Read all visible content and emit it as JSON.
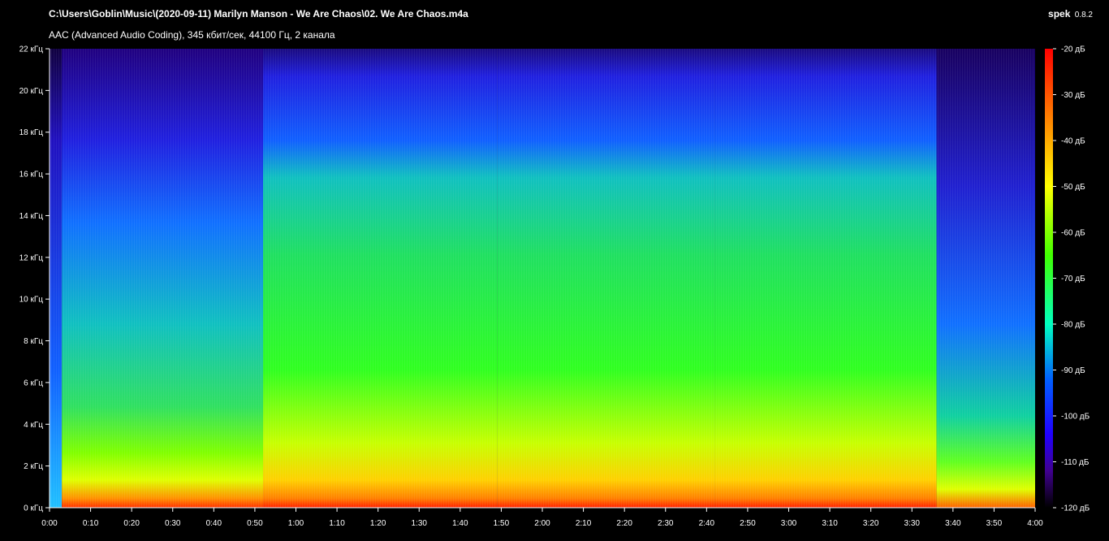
{
  "header": {
    "file_path": "C:\\Users\\Goblin\\Music\\(2020-09-11) Marilyn Manson - We Are Chaos\\02. We Are Chaos.m4a",
    "codec_info": "AAC (Advanced Audio Coding), 345 кбит/сек, 44100 Гц, 2 канала",
    "app_name": "spek",
    "app_version": "0.8.2"
  },
  "chart_data": {
    "type": "heatmap",
    "title": "C:\\Users\\Goblin\\Music\\(2020-09-11) Marilyn Manson - We Are Chaos\\02. We Are Chaos.m4a",
    "subtitle": "AAC (Advanced Audio Coding), 345 кбит/сек, 44100 Гц, 2 канала",
    "x_ticks": [
      "0:00",
      "0:10",
      "0:20",
      "0:30",
      "0:40",
      "0:50",
      "1:00",
      "1:10",
      "1:20",
      "1:30",
      "1:40",
      "1:50",
      "2:00",
      "2:10",
      "2:20",
      "2:30",
      "2:40",
      "2:50",
      "3:00",
      "3:10",
      "3:20",
      "3:30",
      "3:40",
      "3:50",
      "4:00"
    ],
    "y_ticks": [
      "0 кГц",
      "2 кГц",
      "4 кГц",
      "6 кГц",
      "8 кГц",
      "10 кГц",
      "12 кГц",
      "14 кГц",
      "16 кГц",
      "18 кГц",
      "20 кГц",
      "22 кГц"
    ],
    "xlim_seconds": [
      0,
      240
    ],
    "ylim_khz": [
      0,
      22
    ],
    "colorbar_ticks": [
      "-20 дБ",
      "-30 дБ",
      "-40 дБ",
      "-50 дБ",
      "-60 дБ",
      "-70 дБ",
      "-80 дБ",
      "-90 дБ",
      "-100 дБ",
      "-110 дБ",
      "-120 дБ"
    ],
    "colorbar_range_db": [
      -120,
      -20
    ],
    "colormap": [
      "#ff0000",
      "#ff8000",
      "#ffff00",
      "#00ff00",
      "#00ffff",
      "#0040ff",
      "#2000a0",
      "#000000"
    ],
    "sections": [
      {
        "start_s": 0,
        "end_s": 3,
        "level": "low"
      },
      {
        "start_s": 3,
        "end_s": 52,
        "level": "medium"
      },
      {
        "start_s": 52,
        "end_s": 109,
        "level": "high"
      },
      {
        "start_s": 109,
        "end_s": 162,
        "level": "high"
      },
      {
        "start_s": 162,
        "end_s": 216,
        "level": "high"
      },
      {
        "start_s": 216,
        "end_s": 240,
        "level": "fade"
      }
    ]
  }
}
